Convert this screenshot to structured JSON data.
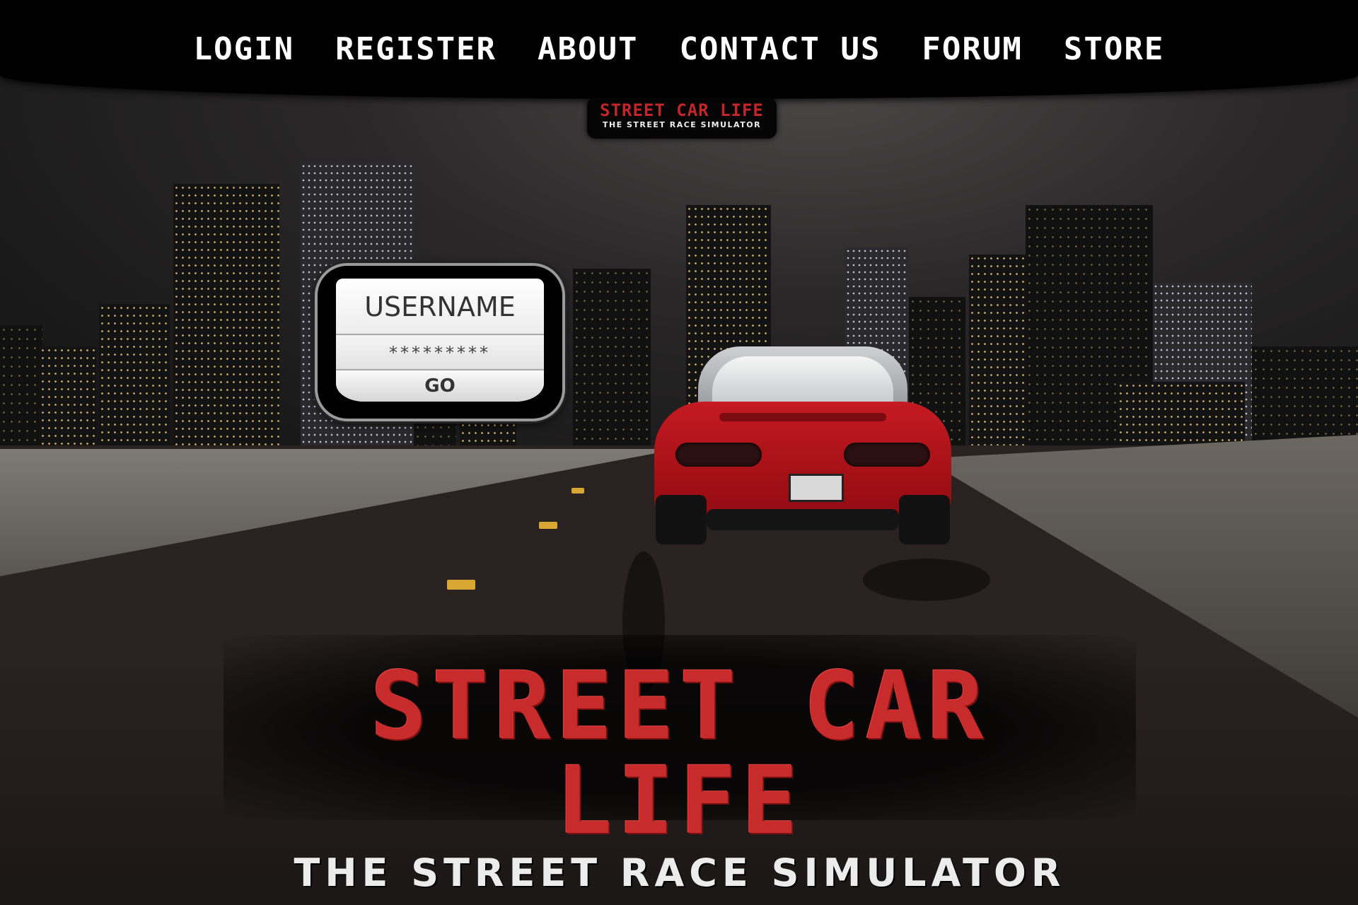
{
  "nav": {
    "items": [
      "LOGIN",
      "REGISTER",
      "ABOUT",
      "CONTACT US",
      "FORUM",
      "STORE"
    ]
  },
  "header_logo": {
    "title": "STREET CAR LIFE",
    "subtitle": "THE STREET RACE SIMULATOR"
  },
  "login_box": {
    "username": "USERNAME",
    "password": "*********",
    "go_label": "GO"
  },
  "hero_logo": {
    "title": "STREET CAR LIFE",
    "subtitle": "THE STREET RACE SIMULATOR"
  },
  "colors": {
    "brand_red": "#c72b2b",
    "nav_bg": "#000000",
    "nav_text": "#ffffff"
  }
}
